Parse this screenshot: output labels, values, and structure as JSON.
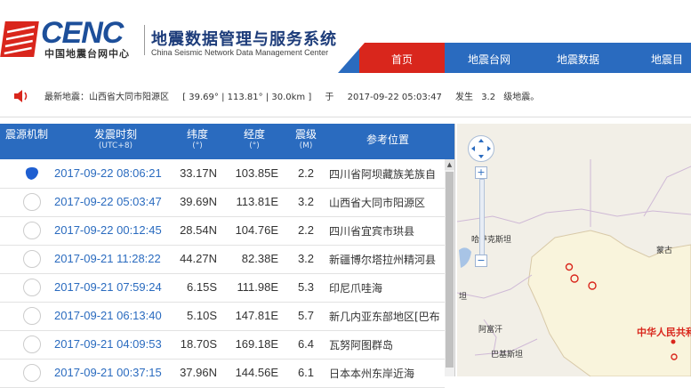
{
  "header": {
    "logo_text": "CENC",
    "logo_sub": "中国地震台网中心",
    "title": "地震数据管理与服务系统",
    "title_en": "China Seismic Network Data Management Center"
  },
  "nav": {
    "items": [
      {
        "label": "首页",
        "active": true
      },
      {
        "label": "地震台网",
        "active": false
      },
      {
        "label": "地震数据",
        "active": false
      },
      {
        "label": "地震目",
        "active": false
      }
    ]
  },
  "marquee": {
    "prefix": "最新地震：山西省大同市阳源区",
    "coords": "[ 39.69° | 113.81° | 30.0km ]",
    "at": "于",
    "time": "2017-09-22 05:03:47",
    "occurred": "发生",
    "mag": "3.2",
    "suffix": "级地震。"
  },
  "table": {
    "headers": [
      {
        "label": "震源机制",
        "unit": ""
      },
      {
        "label": "发震时刻",
        "unit": "(UTC+8)"
      },
      {
        "label": "纬度",
        "unit": "(°)"
      },
      {
        "label": "经度",
        "unit": "(°)"
      },
      {
        "label": "震级",
        "unit": "(M)"
      },
      {
        "label": "参考位置",
        "unit": ""
      }
    ],
    "rows": [
      {
        "time": "2017-09-22 08:06:21",
        "lat": "33.17N",
        "lon": "103.85E",
        "mag": "2.2",
        "loc": "四川省阿坝藏族羌族自"
      },
      {
        "time": "2017-09-22 05:03:47",
        "lat": "39.69N",
        "lon": "113.81E",
        "mag": "3.2",
        "loc": "山西省大同市阳源区"
      },
      {
        "time": "2017-09-22 00:12:45",
        "lat": "28.54N",
        "lon": "104.76E",
        "mag": "2.2",
        "loc": "四川省宜宾市珙县"
      },
      {
        "time": "2017-09-21 11:28:22",
        "lat": "44.27N",
        "lon": "82.38E",
        "mag": "3.2",
        "loc": "新疆博尔塔拉州精河县"
      },
      {
        "time": "2017-09-21 07:59:24",
        "lat": "6.15S",
        "lon": "111.98E",
        "mag": "5.3",
        "loc": "印尼爪哇海"
      },
      {
        "time": "2017-09-21 06:13:40",
        "lat": "5.10S",
        "lon": "147.81E",
        "mag": "5.7",
        "loc": "新几内亚东部地区[巴布"
      },
      {
        "time": "2017-09-21 04:09:53",
        "lat": "18.70S",
        "lon": "169.18E",
        "mag": "6.4",
        "loc": "瓦努阿图群岛"
      },
      {
        "time": "2017-09-21 00:37:15",
        "lat": "37.96N",
        "lon": "144.56E",
        "mag": "6.1",
        "loc": "日本本州东岸近海"
      }
    ]
  },
  "map": {
    "labels": [
      {
        "text": "哈萨克斯坦",
        "kind": "normal"
      },
      {
        "text": "蒙古",
        "kind": "normal"
      },
      {
        "text": "阿富汗",
        "kind": "normal"
      },
      {
        "text": "巴基斯坦",
        "kind": "normal"
      },
      {
        "text": "中华人民共和",
        "kind": "red"
      },
      {
        "text": "坦",
        "kind": "normal"
      }
    ]
  },
  "colors": {
    "nav_blue": "#2a6bbf",
    "brand_red": "#d9261c",
    "logo_blue": "#1d4f9a"
  }
}
